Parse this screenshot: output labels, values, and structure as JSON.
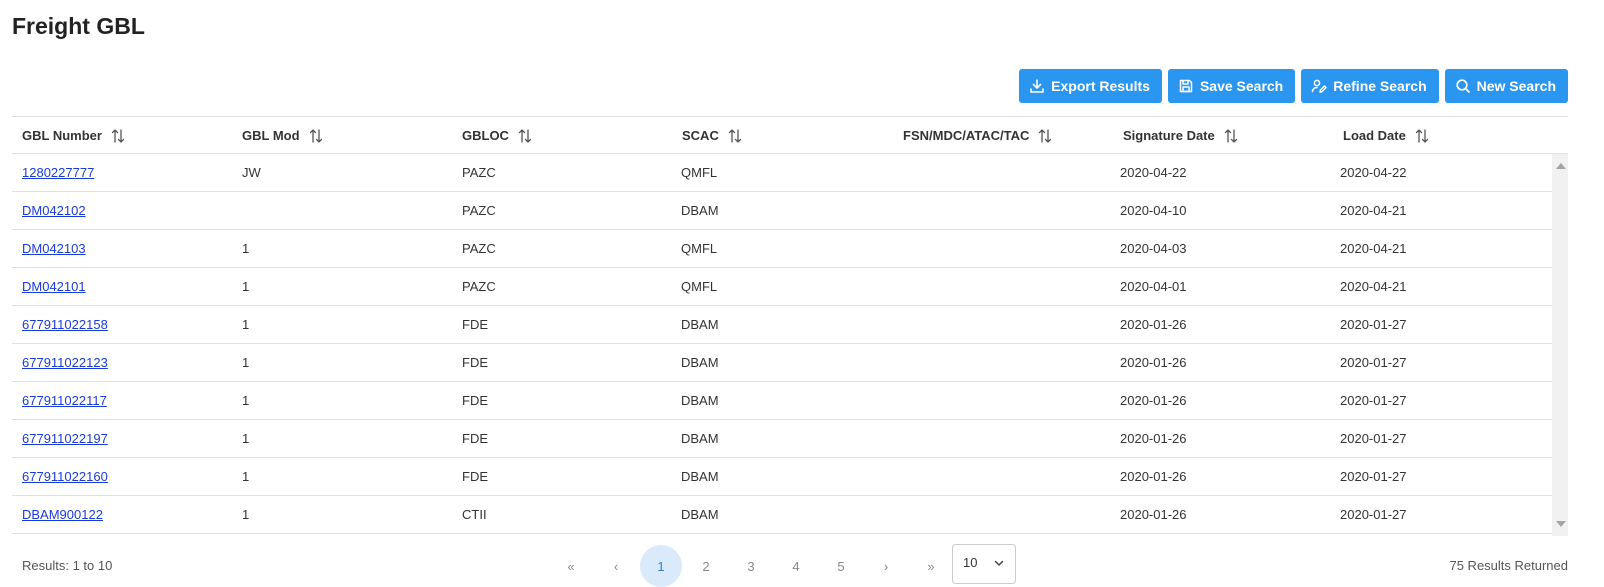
{
  "page": {
    "title": "Freight GBL"
  },
  "toolbar": {
    "export_label": "Export Results",
    "save_label": "Save Search",
    "refine_label": "Refine Search",
    "new_label": "New Search"
  },
  "table": {
    "headers": [
      "GBL Number",
      "GBL Mod",
      "GBLOC",
      "SCAC",
      "FSN/MDC/ATAC/TAC",
      "Signature Date",
      "Load Date"
    ],
    "rows": [
      [
        "1280227777",
        "JW",
        "PAZC",
        "QMFL",
        "",
        "2020-04-22",
        "2020-04-22"
      ],
      [
        "DM042102",
        "",
        "PAZC",
        "DBAM",
        "",
        "2020-04-10",
        "2020-04-21"
      ],
      [
        "DM042103",
        "1",
        "PAZC",
        "QMFL",
        "",
        "2020-04-03",
        "2020-04-21"
      ],
      [
        "DM042101",
        "1",
        "PAZC",
        "QMFL",
        "",
        "2020-04-01",
        "2020-04-21"
      ],
      [
        "677911022158",
        "1",
        "FDE",
        "DBAM",
        "",
        "2020-01-26",
        "2020-01-27"
      ],
      [
        "677911022123",
        "1",
        "FDE",
        "DBAM",
        "",
        "2020-01-26",
        "2020-01-27"
      ],
      [
        "677911022117",
        "1",
        "FDE",
        "DBAM",
        "",
        "2020-01-26",
        "2020-01-27"
      ],
      [
        "677911022197",
        "1",
        "FDE",
        "DBAM",
        "",
        "2020-01-26",
        "2020-01-27"
      ],
      [
        "677911022160",
        "1",
        "FDE",
        "DBAM",
        "",
        "2020-01-26",
        "2020-01-27"
      ],
      [
        "DBAM900122",
        "1",
        "CTII",
        "DBAM",
        "",
        "2020-01-26",
        "2020-01-27"
      ]
    ]
  },
  "footer": {
    "results_range": "Results: 1 to 10",
    "results_total": "75 Results Returned",
    "pager": {
      "first": "«",
      "prev": "‹",
      "pages": [
        "1",
        "2",
        "3",
        "4",
        "5"
      ],
      "active_page": "1",
      "next": "›",
      "last": "»"
    },
    "page_size": "10"
  },
  "colors": {
    "accent": "#2b96f0",
    "link": "#1a3bdc",
    "active_page_bg": "#dbeafb"
  }
}
